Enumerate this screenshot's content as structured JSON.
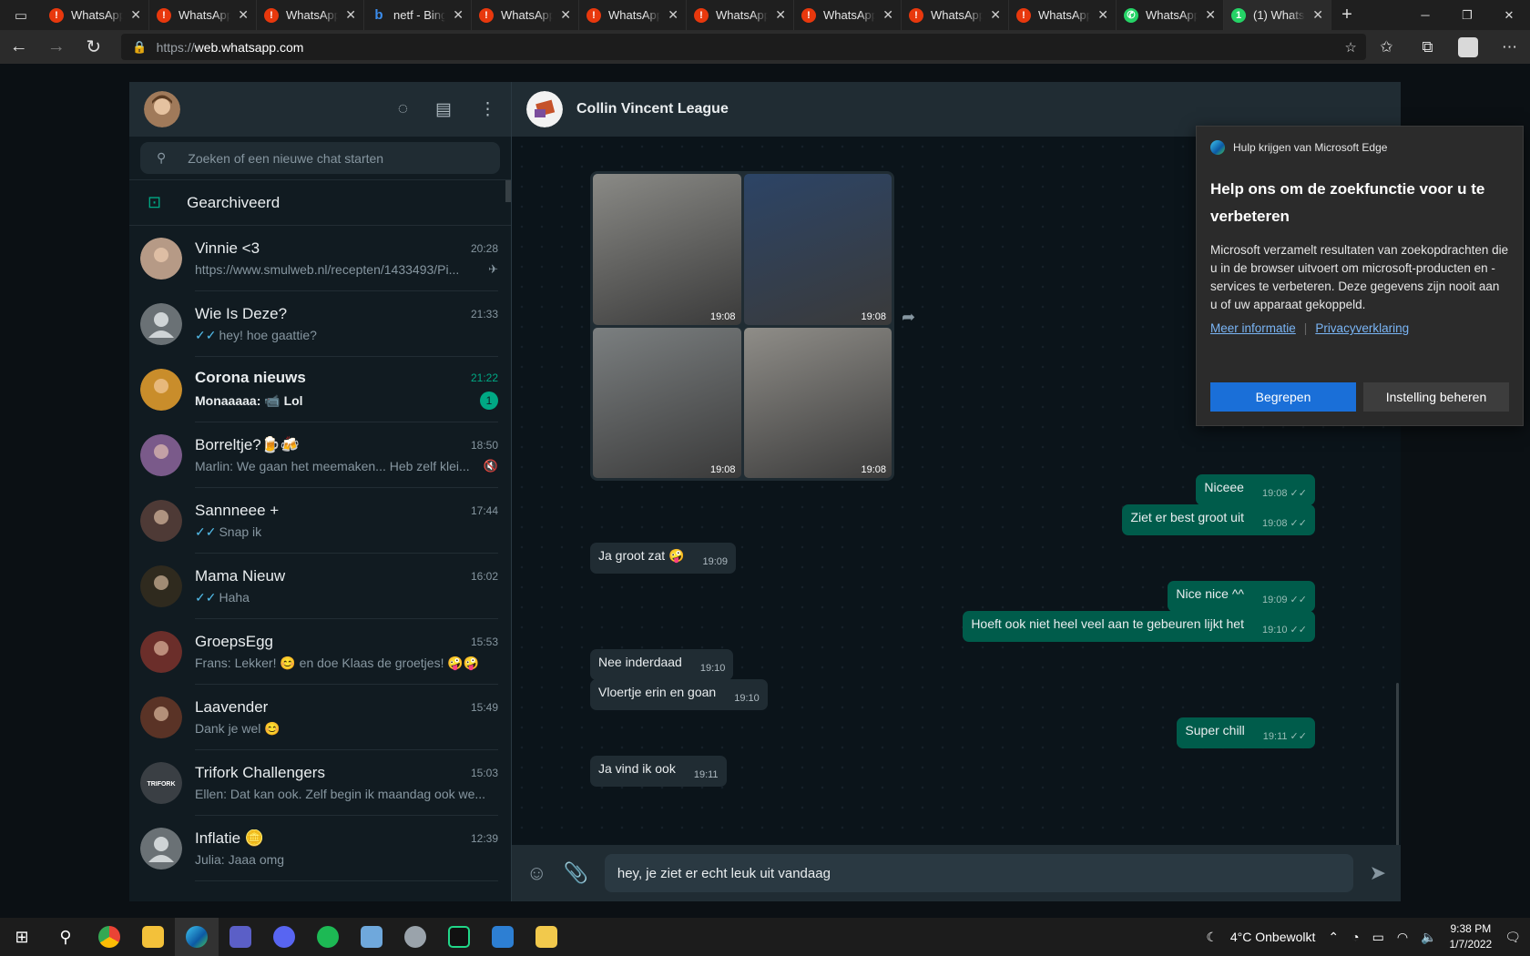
{
  "browser": {
    "tabs": [
      {
        "title": "WhatsApp",
        "icon": "alert"
      },
      {
        "title": "WhatsApp",
        "icon": "alert"
      },
      {
        "title": "WhatsApp",
        "icon": "alert"
      },
      {
        "title": "netf - Bing",
        "icon": "bing"
      },
      {
        "title": "WhatsApp",
        "icon": "alert"
      },
      {
        "title": "WhatsApp",
        "icon": "alert"
      },
      {
        "title": "WhatsApp",
        "icon": "alert"
      },
      {
        "title": "WhatsApp",
        "icon": "alert"
      },
      {
        "title": "WhatsApp",
        "icon": "alert"
      },
      {
        "title": "WhatsApp",
        "icon": "alert"
      },
      {
        "title": "WhatsApp",
        "icon": "whatsapp"
      },
      {
        "title": "(1) WhatsApp",
        "icon": "whatsapp-unread",
        "active": true
      }
    ],
    "url_scheme": "https://",
    "url_host": "web.whatsapp.com"
  },
  "sidebar": {
    "search_placeholder": "Zoeken of een nieuwe chat starten",
    "archived_label": "Gearchiveerd",
    "chats": [
      {
        "name": "Vinnie <3",
        "time": "20:28",
        "preview": "https://www.smulweb.nl/recepten/1433493/Pi...",
        "ticks": false,
        "pinned": true,
        "avatar_color": "#b69a86"
      },
      {
        "name": "Wie Is Deze?",
        "time": "21:33",
        "preview": "hey! hoe gaattie?",
        "ticks": true,
        "avatar_color": "#6a7175",
        "default_avatar": true
      },
      {
        "name": "Corona nieuws",
        "time": "21:22",
        "preview": "Monaaaaa: 📹 Lol",
        "unread": "1",
        "bold": true,
        "avatar_color": "#c98d2b"
      },
      {
        "name": "Borreltje?🍺🍻",
        "time": "18:50",
        "preview": "Marlin: We gaan het meemaken... Heb zelf klei...",
        "muted": true,
        "avatar_color": "#7a5a8a"
      },
      {
        "name": "Sannneee +",
        "time": "17:44",
        "preview": "Snap ik",
        "ticks": true,
        "avatar_color": "#4e3a36"
      },
      {
        "name": "Mama Nieuw",
        "time": "16:02",
        "preview": "Haha",
        "ticks": true,
        "avatar_color": "#2f2a1e"
      },
      {
        "name": "GroepsEgg",
        "time": "15:53",
        "preview": "Frans: Lekker! 😊 en doe Klaas de groetjes! 🤪🤪",
        "avatar_color": "#6b2e2a"
      },
      {
        "name": "Laavender",
        "time": "15:49",
        "preview": "Dank je wel 😊",
        "avatar_color": "#5a3326"
      },
      {
        "name": "Trifork Challengers",
        "time": "15:03",
        "preview": "Ellen: Dat kan ook. Zelf begin ik maandag ook we...",
        "avatar_color": "#3a3f44",
        "avatar_text": "TRIFORK"
      },
      {
        "name": "Inflatie 🪙",
        "time": "12:39",
        "preview": "Julia: Jaaa omg",
        "avatar_color": "#6a7175",
        "default_avatar": true
      }
    ]
  },
  "conversation": {
    "group_name": "Collin Vincent League",
    "images": [
      {
        "time": "19:08",
        "color": "#8a8a86"
      },
      {
        "time": "19:08",
        "color": "#2c4466"
      },
      {
        "time": "19:08",
        "color": "#7b7f80"
      },
      {
        "time": "19:08",
        "color": "#8f8d88"
      }
    ],
    "messages": [
      {
        "dir": "out",
        "text": "Niceee",
        "time": "19:08"
      },
      {
        "dir": "out",
        "text": "Ziet er best groot uit",
        "time": "19:08"
      },
      {
        "dir": "in",
        "text": "Ja groot zat 🤪",
        "time": "19:09"
      },
      {
        "dir": "out",
        "text": "Nice nice ^^",
        "time": "19:09"
      },
      {
        "dir": "out",
        "text": "Hoeft ook niet heel veel aan te gebeuren lijkt het",
        "time": "19:10"
      },
      {
        "dir": "in",
        "text": "Nee inderdaad",
        "time": "19:10"
      },
      {
        "dir": "in",
        "text": "Vloertje erin en goan",
        "time": "19:10"
      },
      {
        "dir": "out",
        "text": "Super chill",
        "time": "19:11"
      },
      {
        "dir": "in",
        "text": "Ja vind ik ook",
        "time": "19:11"
      }
    ],
    "compose_text": "hey, je ziet er echt leuk uit vandaag"
  },
  "popup": {
    "source": "Hulp krijgen van Microsoft Edge",
    "title": "Help ons om de zoekfunctie voor u te verbeteren",
    "body": "Microsoft verzamelt resultaten van zoekopdrachten die u in de browser uitvoert om microsoft-producten en -services te verbeteren. Deze gegevens zijn nooit aan u of uw apparaat gekoppeld.",
    "link_more": "Meer informatie",
    "link_privacy": "Privacyverklaring",
    "btn_ok": "Begrepen",
    "btn_manage": "Instelling beheren"
  },
  "taskbar": {
    "weather": "4°C  Onbewolkt",
    "time": "9:38 PM",
    "date": "1/7/2022"
  }
}
